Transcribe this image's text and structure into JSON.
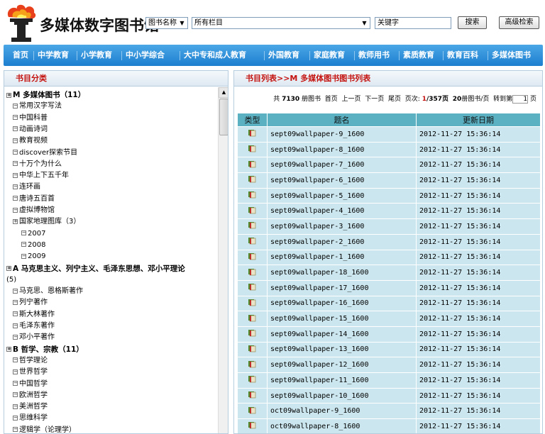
{
  "header": {
    "title": "多媒体数字图书馆",
    "search_field_select": "图书名称",
    "column_select": "所有栏目",
    "keyword_placeholder": "关键字",
    "search_button": "搜索",
    "advanced_button": "高级检索"
  },
  "nav": [
    "首页",
    "中学教育",
    "小学教育",
    "中小学综合",
    "大中专和成人教育",
    "外国教育",
    "家庭教育",
    "教师用书",
    "素质教育",
    "教育百科",
    "多媒体图书"
  ],
  "left": {
    "heading": "书目分类",
    "tree": [
      {
        "text": "M 多媒体图书（11）",
        "kind": "cat",
        "pm": "+"
      },
      {
        "text": "常用汉字写法",
        "kind": "leaf"
      },
      {
        "text": "中国科普",
        "kind": "leaf"
      },
      {
        "text": "动画诗词",
        "kind": "leaf"
      },
      {
        "text": "教育视频",
        "kind": "leaf"
      },
      {
        "text": "discover探索节目",
        "kind": "leaf"
      },
      {
        "text": "十万个为什么",
        "kind": "leaf"
      },
      {
        "text": "中华上下五千年",
        "kind": "leaf"
      },
      {
        "text": "连环画",
        "kind": "leaf"
      },
      {
        "text": "唐诗五百首",
        "kind": "leaf"
      },
      {
        "text": "虚拟博物馆",
        "kind": "leaf"
      },
      {
        "text": "国家地理图库（3）",
        "kind": "sub",
        "pm": "+"
      },
      {
        "text": "2007",
        "kind": "leaf2"
      },
      {
        "text": "2008",
        "kind": "leaf2"
      },
      {
        "text": "2009",
        "kind": "leaf2"
      },
      {
        "text": "A 马克思主义、列宁主义、毛泽东思想、邓小平理论",
        "kind": "cat",
        "pm": "+"
      },
      {
        "text": "(5)",
        "kind": "wrap"
      },
      {
        "text": "马克思、恩格斯著作",
        "kind": "leaf"
      },
      {
        "text": "列宁著作",
        "kind": "leaf"
      },
      {
        "text": "斯大林著作",
        "kind": "leaf"
      },
      {
        "text": "毛泽东著作",
        "kind": "leaf"
      },
      {
        "text": "邓小平著作",
        "kind": "leaf"
      },
      {
        "text": "B 哲学、宗教（11）",
        "kind": "cat",
        "pm": "+"
      },
      {
        "text": "哲学理论",
        "kind": "leaf"
      },
      {
        "text": "世界哲学",
        "kind": "leaf"
      },
      {
        "text": "中国哲学",
        "kind": "leaf"
      },
      {
        "text": "欧洲哲学",
        "kind": "leaf"
      },
      {
        "text": "美洲哲学",
        "kind": "leaf"
      },
      {
        "text": "思维科学",
        "kind": "leaf"
      },
      {
        "text": "逻辑学（论理学）",
        "kind": "leaf"
      }
    ]
  },
  "right": {
    "heading": "书目列表>>M 多媒体图书图书列表",
    "pager": {
      "total_prefix": "共",
      "total": "7130",
      "total_suffix": "册图书",
      "first": "首页",
      "prev": "上一页",
      "next": "下一页",
      "last": "尾页",
      "page_label": "页次:",
      "page_current": "1",
      "page_total": "/357页",
      "per_page": "20",
      "per_page_suffix": "册图书/页",
      "jump_label": "转到第",
      "jump_value": "1",
      "jump_suffix": "页"
    },
    "columns": [
      "类型",
      "题名",
      "更新日期"
    ],
    "rows": [
      {
        "title": "sept09wallpaper-9_1600",
        "date": "2012-11-27 15:36:14"
      },
      {
        "title": "sept09wallpaper-8_1600",
        "date": "2012-11-27 15:36:14"
      },
      {
        "title": "sept09wallpaper-7_1600",
        "date": "2012-11-27 15:36:14"
      },
      {
        "title": "sept09wallpaper-6_1600",
        "date": "2012-11-27 15:36:14"
      },
      {
        "title": "sept09wallpaper-5_1600",
        "date": "2012-11-27 15:36:14"
      },
      {
        "title": "sept09wallpaper-4_1600",
        "date": "2012-11-27 15:36:14"
      },
      {
        "title": "sept09wallpaper-3_1600",
        "date": "2012-11-27 15:36:14"
      },
      {
        "title": "sept09wallpaper-2_1600",
        "date": "2012-11-27 15:36:14"
      },
      {
        "title": "sept09wallpaper-1_1600",
        "date": "2012-11-27 15:36:14"
      },
      {
        "title": "sept09wallpaper-18_1600",
        "date": "2012-11-27 15:36:14"
      },
      {
        "title": "sept09wallpaper-17_1600",
        "date": "2012-11-27 15:36:14"
      },
      {
        "title": "sept09wallpaper-16_1600",
        "date": "2012-11-27 15:36:14"
      },
      {
        "title": "sept09wallpaper-15_1600",
        "date": "2012-11-27 15:36:14"
      },
      {
        "title": "sept09wallpaper-14_1600",
        "date": "2012-11-27 15:36:14"
      },
      {
        "title": "sept09wallpaper-13_1600",
        "date": "2012-11-27 15:36:14"
      },
      {
        "title": "sept09wallpaper-12_1600",
        "date": "2012-11-27 15:36:14"
      },
      {
        "title": "sept09wallpaper-11_1600",
        "date": "2012-11-27 15:36:14"
      },
      {
        "title": "sept09wallpaper-10_1600",
        "date": "2012-11-27 15:36:14"
      },
      {
        "title": "oct09wallpaper-9_1600",
        "date": "2012-11-27 15:36:14"
      },
      {
        "title": "oct09wallpaper-8_1600",
        "date": "2012-11-27 15:36:14"
      }
    ]
  },
  "icons": {
    "logo": "torch-logo-icon",
    "book": "book-icon"
  },
  "colors": {
    "nav": "#1d7fcf",
    "heading_red": "#c4120f",
    "table_head": "#5bb0c2",
    "table_cell": "#cbe6ee"
  }
}
